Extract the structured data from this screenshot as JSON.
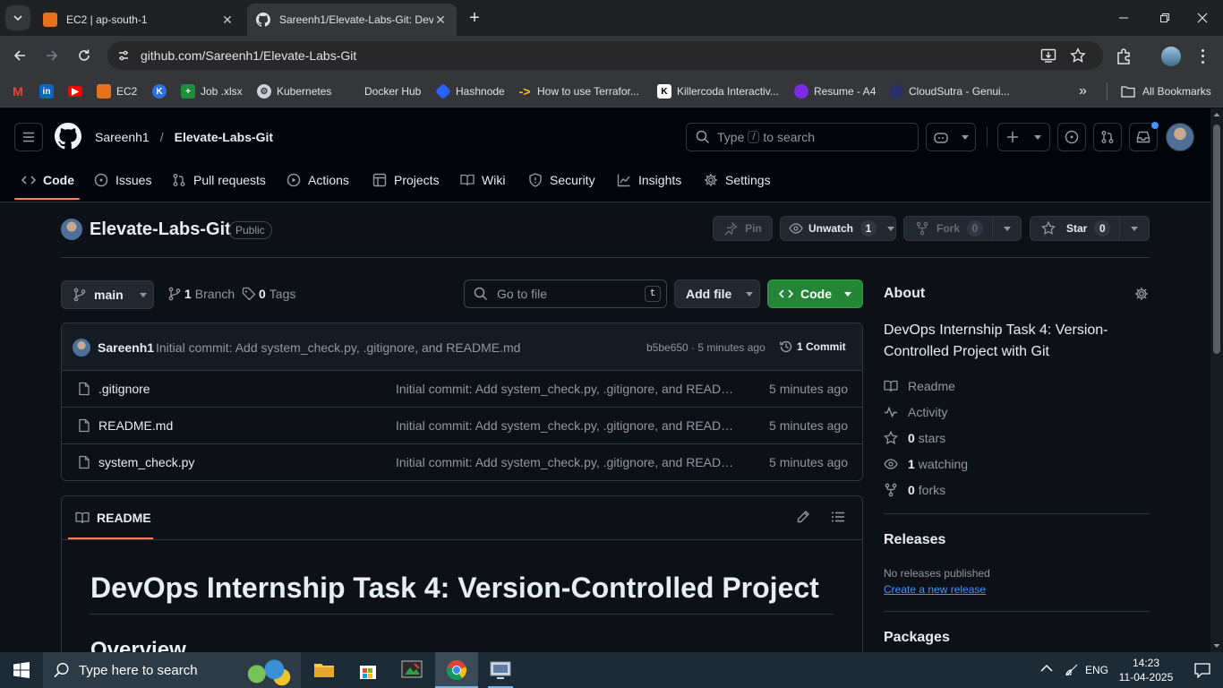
{
  "browser": {
    "tabs": [
      {
        "title": "EC2 | ap-south-1",
        "active": false
      },
      {
        "title": "Sareenh1/Elevate-Labs-Git: Dev",
        "active": true
      }
    ],
    "url": "github.com/Sareenh1/Elevate-Labs-Git",
    "bookmarks": [
      {
        "label": "",
        "icon": "gmail-icon"
      },
      {
        "label": "",
        "icon": "linkedin-icon"
      },
      {
        "label": "",
        "icon": "youtube-icon"
      },
      {
        "label": "EC2",
        "icon": "aws-icon"
      },
      {
        "label": "",
        "icon": "kodekloud-icon"
      },
      {
        "label": "Job .xlsx",
        "icon": "sheets-icon"
      },
      {
        "label": "Kubernetes",
        "icon": "kubernetes-icon"
      },
      {
        "label": "Docker Hub",
        "icon": "docker-icon"
      },
      {
        "label": "Hashnode",
        "icon": "hashnode-icon"
      },
      {
        "label": "How to use Terrafor...",
        "icon": "arrow-icon"
      },
      {
        "label": "Killercoda Interactiv...",
        "icon": "killercoda-icon"
      },
      {
        "label": "Resume - A4",
        "icon": "canva-icon"
      },
      {
        "label": "CloudSutra - Genui...",
        "icon": "cloudsutra-icon"
      }
    ],
    "all_bookmarks": "All Bookmarks"
  },
  "header": {
    "owner": "Sareenh1",
    "separator": "/",
    "repo": "Elevate-Labs-Git",
    "search_prefix": "Type",
    "search_key": "/",
    "search_suffix": "to search"
  },
  "nav": [
    {
      "label": "Code",
      "icon": "code-icon",
      "selected": true
    },
    {
      "label": "Issues",
      "icon": "issue-icon"
    },
    {
      "label": "Pull requests",
      "icon": "pull-request-icon"
    },
    {
      "label": "Actions",
      "icon": "play-icon"
    },
    {
      "label": "Projects",
      "icon": "table-icon"
    },
    {
      "label": "Wiki",
      "icon": "book-icon"
    },
    {
      "label": "Security",
      "icon": "shield-icon"
    },
    {
      "label": "Insights",
      "icon": "graph-icon"
    },
    {
      "label": "Settings",
      "icon": "gear-icon"
    }
  ],
  "repo": {
    "name": "Elevate-Labs-Git",
    "visibility": "Public",
    "pin": "Pin",
    "unwatch": "Unwatch",
    "watch_count": "1",
    "fork": "Fork",
    "fork_count": "0",
    "star": "Star",
    "star_count": "0"
  },
  "files_bar": {
    "branch": "main",
    "branch_count": "1",
    "branch_label": "Branch",
    "tag_count": "0",
    "tag_label": "Tags",
    "goto_placeholder": "Go to file",
    "goto_key": "t",
    "add_file": "Add file",
    "code": "Code"
  },
  "commit": {
    "author": "Sareenh1",
    "message": "Initial commit: Add system_check.py, .gitignore, and README.md",
    "meta": "b5be650 · 5 minutes ago",
    "count": "1 Commit"
  },
  "files": [
    {
      "name": ".gitignore",
      "message": "Initial commit: Add system_check.py, .gitignore, and README.md",
      "time": "5 minutes ago"
    },
    {
      "name": "README.md",
      "message": "Initial commit: Add system_check.py, .gitignore, and README.md",
      "time": "5 minutes ago"
    },
    {
      "name": "system_check.py",
      "message": "Initial commit: Add system_check.py, .gitignore, and README.md",
      "time": "5 minutes ago"
    }
  ],
  "readme": {
    "tab": "README",
    "h1": "DevOps Internship Task 4: Version-Controlled Project",
    "h2": "Overview"
  },
  "about": {
    "title": "About",
    "description": "DevOps Internship Task 4: Version-Controlled Project with Git",
    "readme": "Readme",
    "activity": "Activity",
    "stars_n": "0",
    "stars": "stars",
    "watching_n": "1",
    "watching": "watching",
    "forks_n": "0",
    "forks": "forks",
    "releases_title": "Releases",
    "no_releases": "No releases published",
    "create_release": "Create a new release",
    "packages_title": "Packages"
  },
  "taskbar": {
    "search_placeholder": "Type here to search",
    "lang": "ENG",
    "time": "14:23",
    "date": "11-04-2025"
  },
  "colors": {
    "bg": "#0d1117",
    "header_bg": "#010409",
    "border": "#30363d",
    "accent_orange": "#f78166",
    "green_button": "#238636",
    "link_blue": "#4493f8",
    "muted": "#9198a1"
  }
}
